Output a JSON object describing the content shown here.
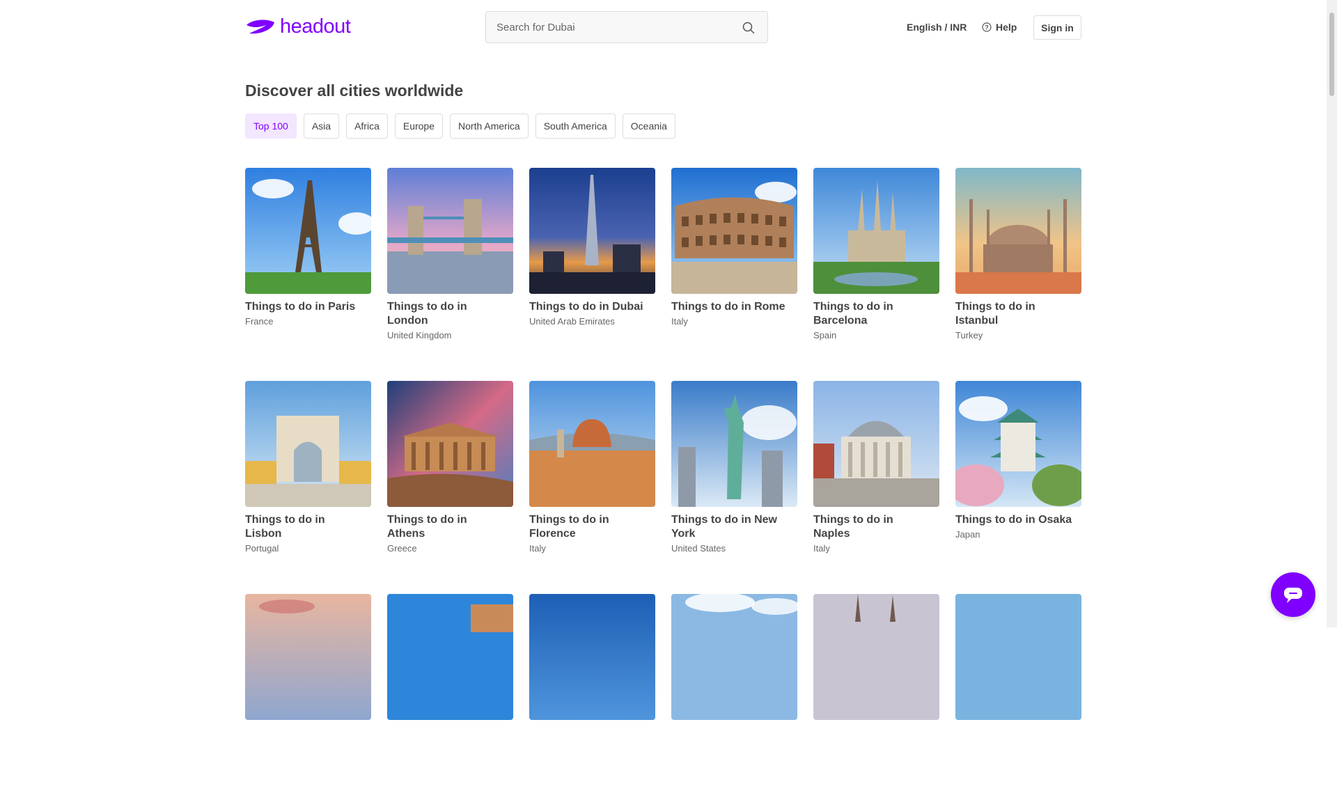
{
  "header": {
    "logo_text": "headout",
    "search_placeholder": "Search for Dubai",
    "language": "English / INR",
    "help": "Help",
    "signin": "Sign in"
  },
  "title": "Discover all cities worldwide",
  "tabs": [
    {
      "label": "Top 100",
      "active": true
    },
    {
      "label": "Asia"
    },
    {
      "label": "Africa"
    },
    {
      "label": "Europe"
    },
    {
      "label": "North America"
    },
    {
      "label": "South America"
    },
    {
      "label": "Oceania"
    }
  ],
  "cities": [
    {
      "title": "Things to do in Paris",
      "country": "France",
      "image": "eiffel-tower"
    },
    {
      "title": "Things to do in London",
      "country": "United Kingdom",
      "image": "tower-bridge"
    },
    {
      "title": "Things to do in Dubai",
      "country": "United Arab Emirates",
      "image": "burj-khalifa"
    },
    {
      "title": "Things to do in Rome",
      "country": "Italy",
      "image": "colosseum"
    },
    {
      "title": "Things to do in Barcelona",
      "country": "Spain",
      "image": "sagrada-familia"
    },
    {
      "title": "Things to do in Istanbul",
      "country": "Turkey",
      "image": "blue-mosque"
    },
    {
      "title": "Things to do in Lisbon",
      "country": "Portugal",
      "image": "rua-augusta-arch"
    },
    {
      "title": "Things to do in Athens",
      "country": "Greece",
      "image": "parthenon"
    },
    {
      "title": "Things to do in Florence",
      "country": "Italy",
      "image": "florence-duomo"
    },
    {
      "title": "Things to do in New York",
      "country": "United States",
      "image": "statue-of-liberty"
    },
    {
      "title": "Things to do in Naples",
      "country": "Italy",
      "image": "san-francesco-di-paola"
    },
    {
      "title": "Things to do in Osaka",
      "country": "Japan",
      "image": "osaka-castle"
    },
    {
      "title": "",
      "country": "",
      "image": "sunset-sky"
    },
    {
      "title": "",
      "country": "",
      "image": "blue-sky-building"
    },
    {
      "title": "",
      "country": "",
      "image": "deep-blue-sky"
    },
    {
      "title": "",
      "country": "",
      "image": "cloudy-sky"
    },
    {
      "title": "",
      "country": "",
      "image": "cathedral-spires"
    },
    {
      "title": "",
      "country": "",
      "image": "pale-blue-sky"
    }
  ],
  "colors": {
    "brand": "#8000ff",
    "active_tab_bg": "#f3e6ff",
    "text": "#444444"
  }
}
